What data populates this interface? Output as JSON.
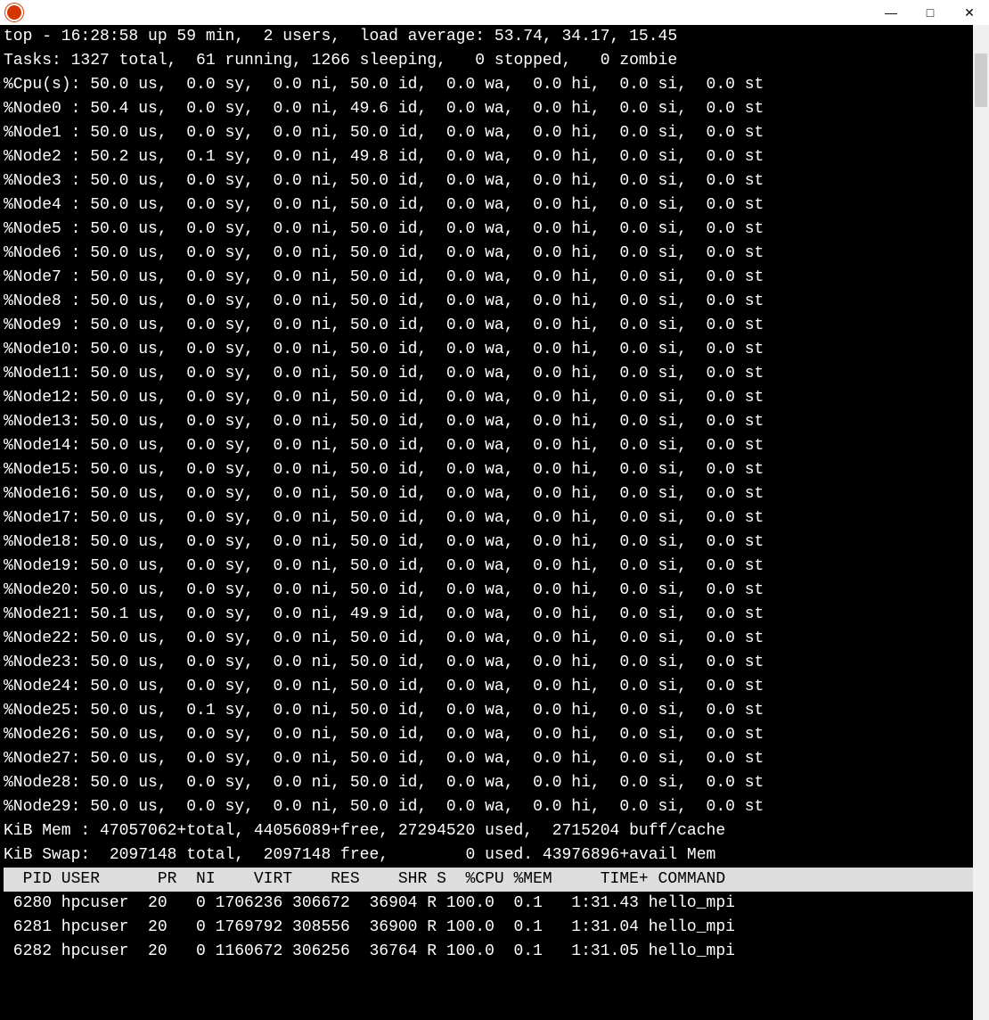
{
  "titlebar": {
    "minimize": "—",
    "maximize": "□",
    "close": "✕"
  },
  "scroll_arrow_up": "▴",
  "top_line": "top - 16:28:58 up 59 min,  2 users,  load average: 53.74, 34.17, 15.45",
  "tasks_line": "Tasks: 1327 total,  61 running, 1266 sleeping,   0 stopped,   0 zombie",
  "cpu_line": "%Cpu(s): 50.0 us,  0.0 sy,  0.0 ni, 50.0 id,  0.0 wa,  0.0 hi,  0.0 si,  0.0 st",
  "nodes": [
    {
      "label": "%Node0 :",
      "us": "50.4",
      "sy": "0.0",
      "ni": "0.0",
      "id": "49.6",
      "wa": "0.0",
      "hi": "0.0",
      "si": "0.0",
      "st": "0.0"
    },
    {
      "label": "%Node1 :",
      "us": "50.0",
      "sy": "0.0",
      "ni": "0.0",
      "id": "50.0",
      "wa": "0.0",
      "hi": "0.0",
      "si": "0.0",
      "st": "0.0"
    },
    {
      "label": "%Node2 :",
      "us": "50.2",
      "sy": "0.1",
      "ni": "0.0",
      "id": "49.8",
      "wa": "0.0",
      "hi": "0.0",
      "si": "0.0",
      "st": "0.0"
    },
    {
      "label": "%Node3 :",
      "us": "50.0",
      "sy": "0.0",
      "ni": "0.0",
      "id": "50.0",
      "wa": "0.0",
      "hi": "0.0",
      "si": "0.0",
      "st": "0.0"
    },
    {
      "label": "%Node4 :",
      "us": "50.0",
      "sy": "0.0",
      "ni": "0.0",
      "id": "50.0",
      "wa": "0.0",
      "hi": "0.0",
      "si": "0.0",
      "st": "0.0"
    },
    {
      "label": "%Node5 :",
      "us": "50.0",
      "sy": "0.0",
      "ni": "0.0",
      "id": "50.0",
      "wa": "0.0",
      "hi": "0.0",
      "si": "0.0",
      "st": "0.0"
    },
    {
      "label": "%Node6 :",
      "us": "50.0",
      "sy": "0.0",
      "ni": "0.0",
      "id": "50.0",
      "wa": "0.0",
      "hi": "0.0",
      "si": "0.0",
      "st": "0.0"
    },
    {
      "label": "%Node7 :",
      "us": "50.0",
      "sy": "0.0",
      "ni": "0.0",
      "id": "50.0",
      "wa": "0.0",
      "hi": "0.0",
      "si": "0.0",
      "st": "0.0"
    },
    {
      "label": "%Node8 :",
      "us": "50.0",
      "sy": "0.0",
      "ni": "0.0",
      "id": "50.0",
      "wa": "0.0",
      "hi": "0.0",
      "si": "0.0",
      "st": "0.0"
    },
    {
      "label": "%Node9 :",
      "us": "50.0",
      "sy": "0.0",
      "ni": "0.0",
      "id": "50.0",
      "wa": "0.0",
      "hi": "0.0",
      "si": "0.0",
      "st": "0.0"
    },
    {
      "label": "%Node10:",
      "us": "50.0",
      "sy": "0.0",
      "ni": "0.0",
      "id": "50.0",
      "wa": "0.0",
      "hi": "0.0",
      "si": "0.0",
      "st": "0.0"
    },
    {
      "label": "%Node11:",
      "us": "50.0",
      "sy": "0.0",
      "ni": "0.0",
      "id": "50.0",
      "wa": "0.0",
      "hi": "0.0",
      "si": "0.0",
      "st": "0.0"
    },
    {
      "label": "%Node12:",
      "us": "50.0",
      "sy": "0.0",
      "ni": "0.0",
      "id": "50.0",
      "wa": "0.0",
      "hi": "0.0",
      "si": "0.0",
      "st": "0.0"
    },
    {
      "label": "%Node13:",
      "us": "50.0",
      "sy": "0.0",
      "ni": "0.0",
      "id": "50.0",
      "wa": "0.0",
      "hi": "0.0",
      "si": "0.0",
      "st": "0.0"
    },
    {
      "label": "%Node14:",
      "us": "50.0",
      "sy": "0.0",
      "ni": "0.0",
      "id": "50.0",
      "wa": "0.0",
      "hi": "0.0",
      "si": "0.0",
      "st": "0.0"
    },
    {
      "label": "%Node15:",
      "us": "50.0",
      "sy": "0.0",
      "ni": "0.0",
      "id": "50.0",
      "wa": "0.0",
      "hi": "0.0",
      "si": "0.0",
      "st": "0.0"
    },
    {
      "label": "%Node16:",
      "us": "50.0",
      "sy": "0.0",
      "ni": "0.0",
      "id": "50.0",
      "wa": "0.0",
      "hi": "0.0",
      "si": "0.0",
      "st": "0.0"
    },
    {
      "label": "%Node17:",
      "us": "50.0",
      "sy": "0.0",
      "ni": "0.0",
      "id": "50.0",
      "wa": "0.0",
      "hi": "0.0",
      "si": "0.0",
      "st": "0.0"
    },
    {
      "label": "%Node18:",
      "us": "50.0",
      "sy": "0.0",
      "ni": "0.0",
      "id": "50.0",
      "wa": "0.0",
      "hi": "0.0",
      "si": "0.0",
      "st": "0.0"
    },
    {
      "label": "%Node19:",
      "us": "50.0",
      "sy": "0.0",
      "ni": "0.0",
      "id": "50.0",
      "wa": "0.0",
      "hi": "0.0",
      "si": "0.0",
      "st": "0.0"
    },
    {
      "label": "%Node20:",
      "us": "50.0",
      "sy": "0.0",
      "ni": "0.0",
      "id": "50.0",
      "wa": "0.0",
      "hi": "0.0",
      "si": "0.0",
      "st": "0.0"
    },
    {
      "label": "%Node21:",
      "us": "50.1",
      "sy": "0.0",
      "ni": "0.0",
      "id": "49.9",
      "wa": "0.0",
      "hi": "0.0",
      "si": "0.0",
      "st": "0.0"
    },
    {
      "label": "%Node22:",
      "us": "50.0",
      "sy": "0.0",
      "ni": "0.0",
      "id": "50.0",
      "wa": "0.0",
      "hi": "0.0",
      "si": "0.0",
      "st": "0.0"
    },
    {
      "label": "%Node23:",
      "us": "50.0",
      "sy": "0.0",
      "ni": "0.0",
      "id": "50.0",
      "wa": "0.0",
      "hi": "0.0",
      "si": "0.0",
      "st": "0.0"
    },
    {
      "label": "%Node24:",
      "us": "50.0",
      "sy": "0.0",
      "ni": "0.0",
      "id": "50.0",
      "wa": "0.0",
      "hi": "0.0",
      "si": "0.0",
      "st": "0.0"
    },
    {
      "label": "%Node25:",
      "us": "50.0",
      "sy": "0.1",
      "ni": "0.0",
      "id": "50.0",
      "wa": "0.0",
      "hi": "0.0",
      "si": "0.0",
      "st": "0.0"
    },
    {
      "label": "%Node26:",
      "us": "50.0",
      "sy": "0.0",
      "ni": "0.0",
      "id": "50.0",
      "wa": "0.0",
      "hi": "0.0",
      "si": "0.0",
      "st": "0.0"
    },
    {
      "label": "%Node27:",
      "us": "50.0",
      "sy": "0.0",
      "ni": "0.0",
      "id": "50.0",
      "wa": "0.0",
      "hi": "0.0",
      "si": "0.0",
      "st": "0.0"
    },
    {
      "label": "%Node28:",
      "us": "50.0",
      "sy": "0.0",
      "ni": "0.0",
      "id": "50.0",
      "wa": "0.0",
      "hi": "0.0",
      "si": "0.0",
      "st": "0.0"
    },
    {
      "label": "%Node29:",
      "us": "50.0",
      "sy": "0.0",
      "ni": "0.0",
      "id": "50.0",
      "wa": "0.0",
      "hi": "0.0",
      "si": "0.0",
      "st": "0.0"
    }
  ],
  "mem_line": "KiB Mem : 47057062+total, 44056089+free, 27294520 used,  2715204 buff/cache",
  "swap_line": "KiB Swap:  2097148 total,  2097148 free,        0 used. 43976896+avail Mem",
  "proc_header": "  PID USER      PR  NI    VIRT    RES    SHR S  %CPU %MEM     TIME+ COMMAND          ",
  "procs": [
    {
      "pid": "6280",
      "user": "hpcuser",
      "pr": "20",
      "ni": "0",
      "virt": "1706236",
      "res": "306672",
      "shr": "36904",
      "s": "R",
      "cpu": "100.0",
      "mem": "0.1",
      "time": "1:31.43",
      "cmd": "hello_mpi"
    },
    {
      "pid": "6281",
      "user": "hpcuser",
      "pr": "20",
      "ni": "0",
      "virt": "1769792",
      "res": "308556",
      "shr": "36900",
      "s": "R",
      "cpu": "100.0",
      "mem": "0.1",
      "time": "1:31.04",
      "cmd": "hello_mpi"
    },
    {
      "pid": "6282",
      "user": "hpcuser",
      "pr": "20",
      "ni": "0",
      "virt": "1160672",
      "res": "306256",
      "shr": "36764",
      "s": "R",
      "cpu": "100.0",
      "mem": "0.1",
      "time": "1:31.05",
      "cmd": "hello_mpi"
    }
  ]
}
